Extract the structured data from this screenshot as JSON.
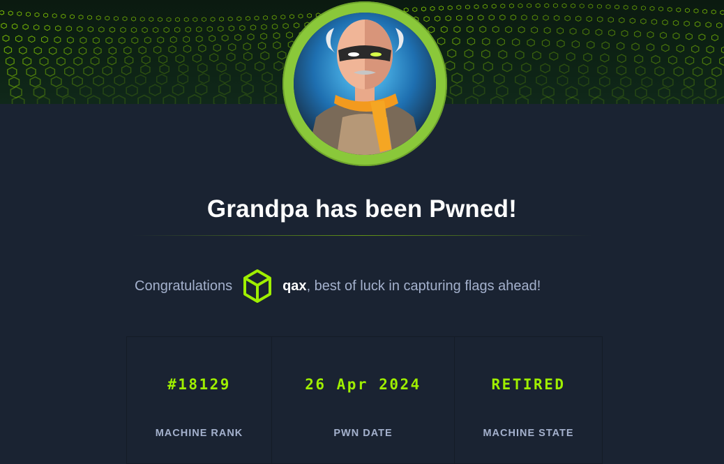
{
  "banner": {
    "image": "green-cube-wave-banner",
    "accent_color": "#9fef00"
  },
  "avatar": {
    "image": "machine-avatar-grandpa",
    "ring_color": "#8ac83a"
  },
  "headline": "Grandpa has been Pwned!",
  "congrats": {
    "prefix": "Congratulations",
    "icon": "cube-icon",
    "username": "qax",
    "suffix": ", best of luck in capturing flags ahead!"
  },
  "stats": [
    {
      "value": "#18129",
      "label": "MACHINE RANK"
    },
    {
      "value": "26 Apr 2024",
      "label": "PWN DATE"
    },
    {
      "value": "RETIRED",
      "label": "MACHINE STATE"
    }
  ],
  "colors": {
    "background": "#1a2332",
    "accent": "#9fef00",
    "muted_text": "#a4b1cd",
    "heading": "#ffffff"
  }
}
